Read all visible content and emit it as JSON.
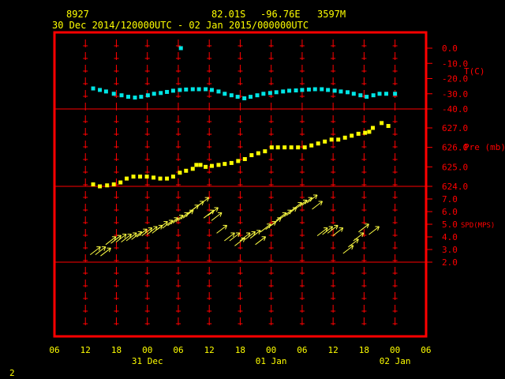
{
  "header": {
    "station_id": "8927",
    "lat": "82.01S",
    "lon": "-96.76E",
    "elev": "3597M",
    "period": "30 Dec 2014/120000UTC - 02 Jan 2015/000000UTC"
  },
  "footer": {
    "page": "2"
  },
  "colors": {
    "frame": "#ff0000",
    "temp": "#00e5e5",
    "pres": "#ffff00",
    "wind": "#ffff44",
    "label": "#ffff00"
  },
  "chart_data": {
    "type": "scatter",
    "x_unit": "hours from 30 Dec 2014 06UTC",
    "x_ticks": [
      {
        "h": 0,
        "label": "06"
      },
      {
        "h": 6,
        "label": "12"
      },
      {
        "h": 12,
        "label": "18"
      },
      {
        "h": 18,
        "label": "00"
      },
      {
        "h": 24,
        "label": "06"
      },
      {
        "h": 30,
        "label": "12"
      },
      {
        "h": 36,
        "label": "18"
      },
      {
        "h": 42,
        "label": "00"
      },
      {
        "h": 48,
        "label": "06"
      },
      {
        "h": 54,
        "label": "12"
      },
      {
        "h": 60,
        "label": "18"
      },
      {
        "h": 66,
        "label": "00"
      },
      {
        "h": 72,
        "label": "06"
      }
    ],
    "date_labels": [
      {
        "h": 18,
        "label": "31 Dec"
      },
      {
        "h": 42,
        "label": "01 Jan"
      },
      {
        "h": 66,
        "label": "02 Jan"
      }
    ],
    "panels": {
      "temp": {
        "ylabel": "T(C)",
        "ticks": [
          "0.0",
          "-10.0",
          "-20.0",
          "-30.0",
          "-40.0"
        ],
        "tick_values": [
          0,
          -10,
          -20,
          -30,
          -40
        ],
        "ylim": [
          -40,
          0
        ],
        "points": [
          [
            7.5,
            -26.5
          ],
          [
            8.8,
            -27.5
          ],
          [
            10,
            -28.5
          ],
          [
            11.5,
            -30
          ],
          [
            13,
            -31
          ],
          [
            14.3,
            -32
          ],
          [
            15.6,
            -32.5
          ],
          [
            16.8,
            -32
          ],
          [
            18.1,
            -31
          ],
          [
            19.3,
            -30
          ],
          [
            20.6,
            -29.5
          ],
          [
            21.8,
            -28.8
          ],
          [
            23,
            -28
          ],
          [
            24.3,
            -27.5
          ],
          [
            25.5,
            -27.2
          ],
          [
            26.8,
            -27
          ],
          [
            28,
            -27
          ],
          [
            29.3,
            -27
          ],
          [
            30.5,
            -27.5
          ],
          [
            31.8,
            -28.5
          ],
          [
            33,
            -30
          ],
          [
            34.3,
            -31
          ],
          [
            35.5,
            -32
          ],
          [
            36.8,
            -33
          ],
          [
            38,
            -32
          ],
          [
            39.3,
            -31
          ],
          [
            40.5,
            -30
          ],
          [
            41.8,
            -29.5
          ],
          [
            43,
            -29
          ],
          [
            44.3,
            -28.5
          ],
          [
            45.5,
            -28
          ],
          [
            46.8,
            -27.8
          ],
          [
            48,
            -27.5
          ],
          [
            49.3,
            -27.2
          ],
          [
            50.5,
            -27
          ],
          [
            51.8,
            -27
          ],
          [
            53,
            -27.5
          ],
          [
            54.3,
            -28
          ],
          [
            55.5,
            -28.5
          ],
          [
            56.8,
            -29
          ],
          [
            58,
            -30
          ],
          [
            59.3,
            -31
          ],
          [
            60.5,
            -32
          ],
          [
            61.8,
            -31
          ],
          [
            63,
            -30
          ],
          [
            64.3,
            -30
          ],
          [
            66,
            -30
          ],
          [
            24.5,
            0
          ]
        ]
      },
      "pres": {
        "ylabel": "Pre (mb)",
        "ticks": [
          "627.0",
          "626.0",
          "625.0",
          "624.0"
        ],
        "tick_values": [
          627,
          626,
          625,
          624
        ],
        "ylim": [
          623.9,
          627.5
        ],
        "points": [
          [
            7.5,
            624.1
          ],
          [
            8.8,
            624.0
          ],
          [
            10.2,
            624.05
          ],
          [
            11.5,
            624.1
          ],
          [
            12.8,
            624.2
          ],
          [
            14,
            624.4
          ],
          [
            15.3,
            624.5
          ],
          [
            16.6,
            624.5
          ],
          [
            17.9,
            624.5
          ],
          [
            19.2,
            624.45
          ],
          [
            20.5,
            624.4
          ],
          [
            21.8,
            624.4
          ],
          [
            23,
            624.5
          ],
          [
            24.3,
            624.7
          ],
          [
            25.5,
            624.8
          ],
          [
            26.8,
            624.9
          ],
          [
            27.5,
            625.1
          ],
          [
            28.3,
            625.1
          ],
          [
            29.3,
            625.0
          ],
          [
            30.5,
            625.05
          ],
          [
            31.8,
            625.1
          ],
          [
            33,
            625.15
          ],
          [
            34.3,
            625.2
          ],
          [
            35.6,
            625.3
          ],
          [
            36.9,
            625.4
          ],
          [
            38.2,
            625.6
          ],
          [
            39.5,
            625.7
          ],
          [
            40.8,
            625.8
          ],
          [
            42.1,
            626.0
          ],
          [
            43.3,
            626.0
          ],
          [
            44.6,
            626.0
          ],
          [
            45.9,
            626.0
          ],
          [
            47.2,
            626.0
          ],
          [
            48.5,
            626.0
          ],
          [
            49.8,
            626.1
          ],
          [
            51.1,
            626.2
          ],
          [
            52.4,
            626.3
          ],
          [
            53.7,
            626.4
          ],
          [
            55,
            626.4
          ],
          [
            56.3,
            626.5
          ],
          [
            57.6,
            626.6
          ],
          [
            58.9,
            626.7
          ],
          [
            60.2,
            626.75
          ],
          [
            61,
            626.8
          ],
          [
            61.7,
            627.0
          ],
          [
            63.4,
            627.25
          ],
          [
            64.7,
            627.1
          ]
        ]
      },
      "wind": {
        "ylabel": "SPD(MPS)",
        "ticks": [
          "7.0",
          "6.0",
          "5.0",
          "4.0",
          "3.0",
          "2.0"
        ],
        "tick_values": [
          7,
          6,
          5,
          4,
          3,
          2
        ],
        "ylim": [
          2,
          7
        ],
        "barbs": [
          [
            8,
            2.9
          ],
          [
            9,
            2.9
          ],
          [
            10,
            2.8
          ],
          [
            11,
            3.7
          ],
          [
            12,
            3.8
          ],
          [
            13,
            3.9
          ],
          [
            14,
            3.9
          ],
          [
            15,
            4.0
          ],
          [
            16,
            4.1
          ],
          [
            17,
            4.3
          ],
          [
            18,
            4.4
          ],
          [
            19,
            4.5
          ],
          [
            20,
            4.6
          ],
          [
            21,
            4.9
          ],
          [
            22,
            5.0
          ],
          [
            23,
            5.2
          ],
          [
            24,
            5.4
          ],
          [
            25,
            5.6
          ],
          [
            26,
            5.8
          ],
          [
            27,
            6.2
          ],
          [
            28,
            6.5
          ],
          [
            29,
            6.8
          ],
          [
            30,
            5.8
          ],
          [
            30.8,
            6.0
          ],
          [
            31.5,
            5.6
          ],
          [
            32.5,
            4.6
          ],
          [
            34,
            4.0
          ],
          [
            35,
            4.0
          ],
          [
            36,
            3.6
          ],
          [
            37,
            4.0
          ],
          [
            38,
            4.1
          ],
          [
            39,
            4.2
          ],
          [
            40,
            3.7
          ],
          [
            41,
            4.7
          ],
          [
            42,
            4.9
          ],
          [
            43,
            5.2
          ],
          [
            44,
            5.6
          ],
          [
            45,
            5.8
          ],
          [
            46,
            6.0
          ],
          [
            47,
            6.4
          ],
          [
            48,
            6.6
          ],
          [
            49,
            6.8
          ],
          [
            50,
            7.0
          ],
          [
            51,
            6.5
          ],
          [
            52,
            4.4
          ],
          [
            53,
            4.5
          ],
          [
            54,
            4.6
          ],
          [
            55,
            4.4
          ],
          [
            57,
            3.0
          ],
          [
            58,
            3.5
          ],
          [
            59,
            4.0
          ],
          [
            60,
            4.7
          ],
          [
            62,
            4.5
          ]
        ]
      }
    }
  }
}
